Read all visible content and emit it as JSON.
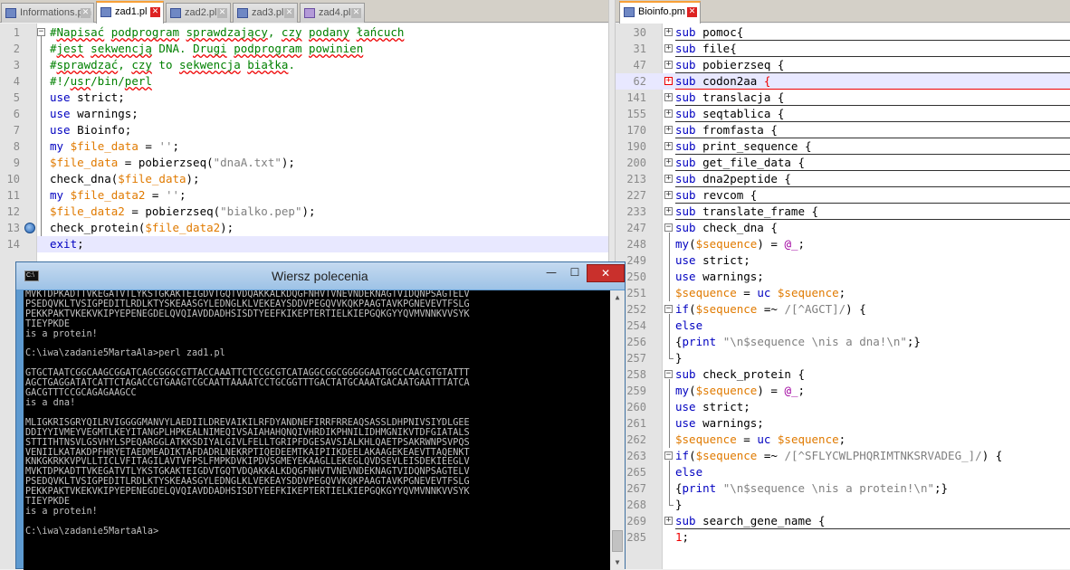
{
  "left_tabs": [
    {
      "label": "Informations.pm",
      "active": false,
      "icon": "file-icon"
    },
    {
      "label": "zad1.pl",
      "active": true,
      "icon": "file-icon"
    },
    {
      "label": "zad2.pl",
      "active": false,
      "icon": "file-icon"
    },
    {
      "label": "zad3.pl",
      "active": false,
      "icon": "file-icon"
    },
    {
      "label": "zad4.pl",
      "active": false,
      "icon": "file-purple-icon"
    }
  ],
  "right_tabs": [
    {
      "label": "Bioinfo.pm",
      "active": true,
      "icon": "file-icon"
    }
  ],
  "left_editor": {
    "lines": [
      {
        "num": "1",
        "html": "<span class='cmt'>#<span class='sq'>Napisać</span> <span class='sq'>podprogram</span> <span class='sq'>sprawdzający</span>, <span class='sq'>czy</span> <span class='sq'>podany</span> <span class='sq'>łańcuch</span></span>"
      },
      {
        "num": "2",
        "html": "<span class='cmt'>#<span class='sq'>jest</span> <span class='sq'>sekwencją</span> DNA. <span class='sq'>Drugi</span> <span class='sq'>podprogram</span> <span class='sq'>powinien</span></span>"
      },
      {
        "num": "3",
        "html": "<span class='cmt'>#<span class='sq'>sprawdzać</span>, <span class='sq'>czy</span> to <span class='sq'>sekwencja</span> <span class='sq'>białka</span>.</span>"
      },
      {
        "num": "4",
        "html": "<span class='cmt'>#!/<span class='sq'>usr</span>/bin/<span class='sq'>perl</span></span>"
      },
      {
        "num": "5",
        "html": "<span class='kw'>use</span> strict;"
      },
      {
        "num": "6",
        "html": "<span class='kw'>use</span> warnings;"
      },
      {
        "num": "7",
        "html": "<span class='kw'>use</span> Bioinfo;"
      },
      {
        "num": "8",
        "html": "<span class='kw'>my</span> <span class='var'>$file_data</span> = <span class='str'>''</span>;"
      },
      {
        "num": "9",
        "html": "<span class='var'>$file_data</span> = pobierzseq(<span class='str'>\"dnaA.txt\"</span>);"
      },
      {
        "num": "10",
        "html": "check_dna(<span class='var'>$file_data</span>);"
      },
      {
        "num": "11",
        "html": "<span class='kw'>my</span> <span class='var'>$file_data2</span> = <span class='str'>''</span>;"
      },
      {
        "num": "12",
        "html": "<span class='var'>$file_data2</span> = pobierzseq(<span class='str'>\"bialko.pep\"</span>);"
      },
      {
        "num": "13",
        "html": "check_protein(<span class='var'>$file_data2</span>);",
        "bookmark": true
      },
      {
        "num": "14",
        "html": "<span class='kw'>exit</span>;",
        "current": true
      }
    ]
  },
  "right_editor": {
    "lines": [
      {
        "num": "30",
        "html": "<span class='kw'>sub</span> pomoc{",
        "fold": "plus"
      },
      {
        "num": "31",
        "html": "<span class='kw'>sub</span> file{",
        "fold": "plus"
      },
      {
        "num": "47",
        "html": "<span class='kw'>sub</span> pobierzseq {",
        "fold": "plus"
      },
      {
        "num": "62",
        "html": "<span class='kw'>sub</span> codon2aa <span style='color:#e00'>{</span>",
        "fold": "plus-red",
        "current": true
      },
      {
        "num": "141",
        "html": "<span class='kw'>sub</span> translacja {",
        "fold": "plus"
      },
      {
        "num": "155",
        "html": "<span class='kw'>sub</span> seqtablica {",
        "fold": "plus"
      },
      {
        "num": "170",
        "html": "<span class='kw'>sub</span> fromfasta {",
        "fold": "plus"
      },
      {
        "num": "190",
        "html": "<span class='kw'>sub</span> print_sequence {",
        "fold": "plus"
      },
      {
        "num": "200",
        "html": "<span class='kw'>sub</span> get_file_data {",
        "fold": "plus"
      },
      {
        "num": "213",
        "html": "<span class='kw'>sub</span> dna2peptide {",
        "fold": "plus"
      },
      {
        "num": "227",
        "html": "<span class='kw'>sub</span> revcom {",
        "fold": "plus"
      },
      {
        "num": "233",
        "html": "<span class='kw'>sub</span> translate_frame {",
        "fold": "plus"
      },
      {
        "num": "247",
        "html": "<span class='kw'>sub</span> check_dna {",
        "fold": "minus"
      },
      {
        "num": "248",
        "html": "<span class='kw'>my</span>(<span class='var'>$sequence</span>) = <span style='color:#a000a0'>@_</span>;",
        "fold": "bar"
      },
      {
        "num": "249",
        "html": "<span class='kw'>use</span> strict;",
        "fold": "bar"
      },
      {
        "num": "250",
        "html": "<span class='kw'>use</span> warnings;",
        "fold": "bar"
      },
      {
        "num": "251",
        "html": "<span class='var'>$sequence</span> = <span class='kw'>uc</span> <span class='var'>$sequence</span>;",
        "fold": "bar"
      },
      {
        "num": "252",
        "html": "<span class='kw'>if</span>(<span class='var'>$sequence</span> =~ <span class='str'>/[^AGCT]/</span>) {",
        "fold": "minus"
      },
      {
        "num": "254",
        "html": "<span class='kw'>else</span>",
        "fold": "bar"
      },
      {
        "num": "256",
        "html": "{<span class='kw'>print</span> <span class='str'>\"\\n$sequence \\nis a dna!\\n\"</span>;}",
        "fold": "bar"
      },
      {
        "num": "257",
        "html": "}",
        "fold": "end"
      },
      {
        "num": "258",
        "html": "<span class='kw'>sub</span> check_protein {",
        "fold": "minus"
      },
      {
        "num": "259",
        "html": "<span class='kw'>my</span>(<span class='var'>$sequence</span>) = <span style='color:#a000a0'>@_</span>;",
        "fold": "bar"
      },
      {
        "num": "260",
        "html": "<span class='kw'>use</span> strict;",
        "fold": "bar"
      },
      {
        "num": "261",
        "html": "<span class='kw'>use</span> warnings;",
        "fold": "bar"
      },
      {
        "num": "262",
        "html": "<span class='var'>$sequence</span> = <span class='kw'>uc</span> <span class='var'>$sequence</span>;",
        "fold": "bar"
      },
      {
        "num": "263",
        "html": "<span class='kw'>if</span>(<span class='var'>$sequence</span> =~ <span class='str'>/[^SFLYCWLPHQRIMTNKSRVADEG_]/</span>) {",
        "fold": "minus"
      },
      {
        "num": "265",
        "html": "<span class='kw'>else</span>",
        "fold": "bar"
      },
      {
        "num": "267",
        "html": "{<span class='kw'>print</span> <span class='str'>\"\\n$sequence \\nis a protein!\\n\"</span>;}",
        "fold": "bar"
      },
      {
        "num": "268",
        "html": "}",
        "fold": "end"
      },
      {
        "num": "269",
        "html": "<span class='kw'>sub</span> search_gene_name {",
        "fold": "plus"
      },
      {
        "num": "285",
        "html": "<span style='color:#e00'>1</span>;"
      }
    ]
  },
  "cmd_window": {
    "title": "Wiersz polecenia",
    "output": "MVKTDPKADTTVKEGATVTLYKSTGKAKTEIGDVTGQTVDQAKKALKDQGFNHVTVNEVNDEKNAGTVIDQNPSAGTELV\nPSEDQVKLTVSIGPEDITLRDLKTYSKEAASGYLEDNGLKLVEKEAYSDDVPEGQVVKQKPAAGTAVKPGNEVEVTFSLG\nPEKKPAKTVKEKVKIPYEPENEGDELQVQIAVDDADHSISDTYEEFKIKEPTERTIELKIEPGQKGYYQVMVNNKVVSYK\nTIEYPKDE\nis a protein!\n\nC:\\iwa\\zadanie5MartaAla>perl zad1.pl\n\nGTGCTAATCGGCAAGCGGATCAGCGGGCGTTACCAAATTCTCCGCGTCATAGGCGGCGGGGGAATGGCCAACGTGTATTT\nAGCTGAGGATATCATTCTAGACCGTGAAGTCGCAATTAAAATCCTGCGGTTTGACTATGCAAATGACAATGAATTTATCA\nGACGTTTCCGCAGAGAAGCC\nis a dna!\n\nMLIGKRISGRYQILRVIGGGGMANVYLAEDIILDREVAIKILRFDYANDNEFIRRFRREAQSASSLDHPNIVSIYDLGEE\nDDIYYIVMEYVEGMTLKEYITANGPLHPKEALNIMEQIVSAIAHAHQNQIVHRDIKPHNILIDHMGNIKVTDFGIATALS\nSTTITHTNSVLGSVHYLSPEQARGGLATKKSDIYALGIVLFELLTGRIPFDGESAVSIALKHLQAETPSAKRWNPSVPQS\nVENIILKATAKDPFHRYETAEDMEADIKTAFDADRLNEKRPTIQEDEEMTKAIPIIKDEELAKAAGEKEAEVTTAQENKT\nKNKGKRKKVPVLLTICLVFITAGILAVTVFPSLFMPKDVKIPDVSGMEYEKAAGLLEKEGLQVDSEVLEISDEKIEEGLV\nMVKTDPKADTTVKEGATVTLYKSTGKAKTEIGDVTGQTVDQAKKALKDQGFNHVTVNEVNDEKNAGTVIDQNPSAGTELV\nPSEDQVKLTVSIGPEDITLRDLKTYSKEAASGYLEDNGLKLVEKEAYSDDVPEGQVVKQKPAAGTAVKPGNEVEVTFSLG\nPEKKPAKTVKEKVKIPYEPENEGDELQVQIAVDDADHSISDTYEEFKIKEPTERTIELKIEPGQKGYYQVMVNNKVVSYK\nTIEYPKDE\nis a protein!\n\nC:\\iwa\\zadanie5MartaAla>",
    "minimize_label": "—",
    "maximize_label": "☐",
    "close_label": "✕"
  }
}
